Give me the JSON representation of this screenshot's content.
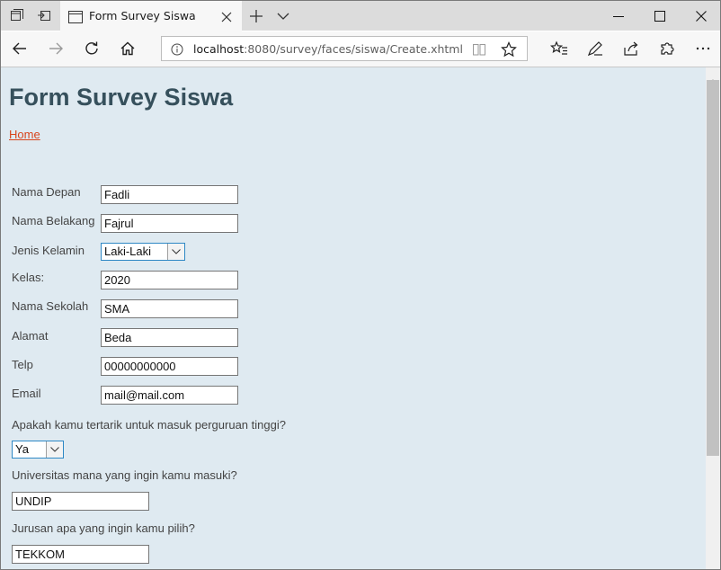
{
  "browser": {
    "tab_title": "Form Survey Siswa",
    "url_host": "localhost",
    "url_path": ":8080/survey/faces/siswa/Create.xhtml"
  },
  "page": {
    "title": "Form Survey Siswa",
    "home_link": "Home"
  },
  "form": {
    "fields": [
      {
        "label": "Nama Depan",
        "value": "Fadli"
      },
      {
        "label": "Nama Belakang",
        "value": "Fajrul"
      },
      {
        "label": "Jenis Kelamin",
        "value": "Laki-Laki"
      },
      {
        "label": "Kelas:",
        "value": "2020"
      },
      {
        "label": "Nama Sekolah",
        "value": "SMA"
      },
      {
        "label": "Alamat",
        "value": "Beda"
      },
      {
        "label": "Telp",
        "value": "00000000000"
      },
      {
        "label": "Email",
        "value": "mail@mail.com"
      }
    ],
    "questions": [
      {
        "label": "Apakah kamu tertarik untuk masuk perguruan tinggi?",
        "value": "Ya"
      },
      {
        "label": "Universitas mana yang ingin kamu masuki?",
        "value": "UNDIP"
      },
      {
        "label": "Jurusan apa yang ingin kamu pilih?",
        "value": "TEKKOM"
      }
    ]
  },
  "colors": {
    "page_background": "#dfeaf1",
    "title_color": "#36505c",
    "link_color": "#d8451d",
    "select_border": "#2e88c5"
  }
}
